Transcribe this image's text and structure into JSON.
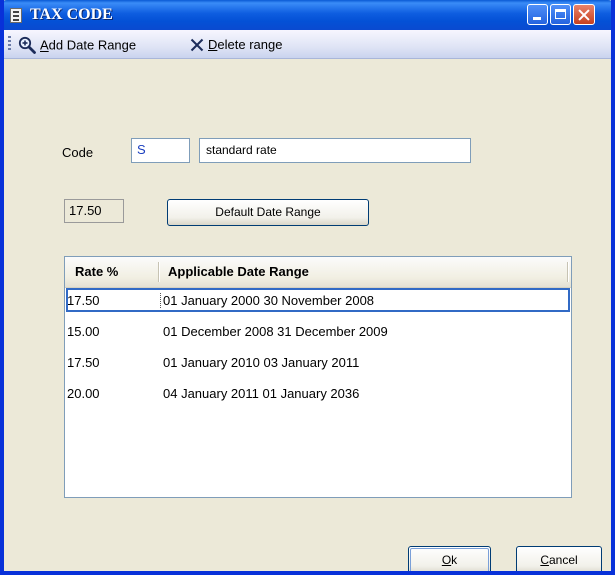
{
  "window": {
    "title": "TAX CODE"
  },
  "toolbar": {
    "add_label": "Add Date Range",
    "add_mnemonic": "A",
    "delete_label": "Delete range",
    "delete_mnemonic": "D"
  },
  "form": {
    "code_label": "Code",
    "code_value": "S",
    "description_value": "standard rate",
    "current_rate": "17.50",
    "default_range_button": "Default Date Range"
  },
  "grid": {
    "columns": [
      "Rate %",
      "Applicable Date Range"
    ],
    "rows": [
      {
        "rate": "17.50",
        "range": "01 January 2000   30 November 2008"
      },
      {
        "rate": "15.00",
        "range": "01 December 2008  31 December 2009"
      },
      {
        "rate": "17.50",
        "range": "01 January 2010   03 January 2011"
      },
      {
        "rate": "20.00",
        "range": "04 January 2011   01 January 2036"
      }
    ],
    "selected_row": 0
  },
  "buttons": {
    "ok": "Ok",
    "ok_mnemonic": "O",
    "cancel": "Cancel",
    "cancel_mnemonic": "C"
  },
  "colors": {
    "titlebar": "#0a5ad4",
    "face": "#ece9d8",
    "selection": "#316ac5"
  }
}
